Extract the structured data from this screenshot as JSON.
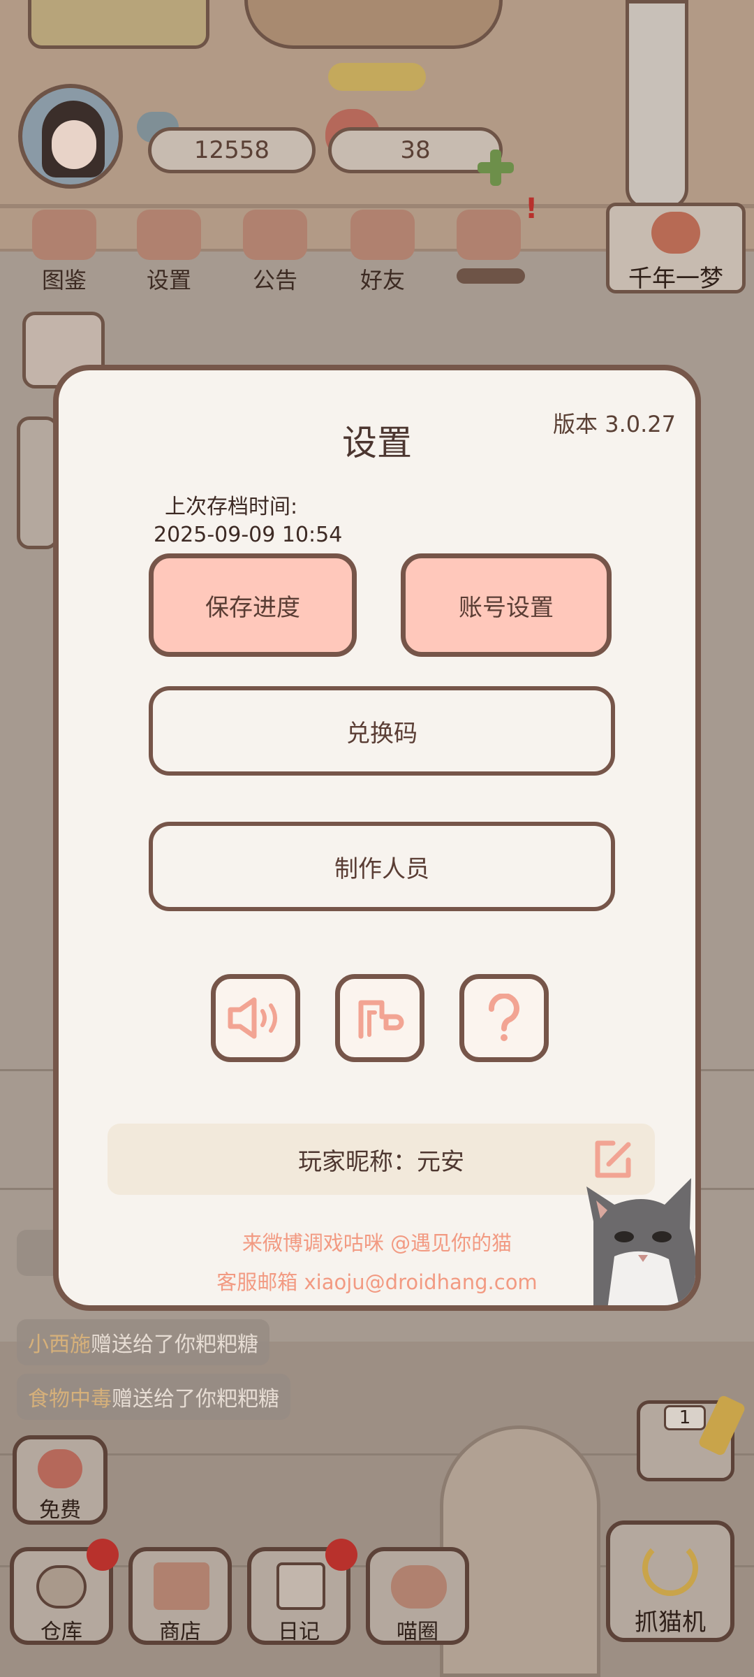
{
  "hud": {
    "fish_count": "12558",
    "heart_count": "38",
    "menu": [
      "图鉴",
      "设置",
      "公告",
      "好友"
    ],
    "badge": "!",
    "player_title": "千年一梦"
  },
  "chat": [
    {
      "name": "小西施",
      "text": "赠送给了你粑粑糖"
    },
    {
      "name": "食物中毒",
      "text": "赠送给了你粑粑糖"
    }
  ],
  "side": {
    "free": "免费",
    "claw_count": "1",
    "claw_machine": "抓猫机"
  },
  "bottom_nav": [
    "仓库",
    "商店",
    "日记",
    "喵圈"
  ],
  "dialog": {
    "title": "设置",
    "version": "版本 3.0.27",
    "save_time_label": "上次存档时间:",
    "save_time_value": "2025-09-09 10:54",
    "save_progress": "保存进度",
    "account_settings": "账号设置",
    "redeem_code": "兑换码",
    "credits": "制作人员",
    "nickname": "玩家昵称：元安",
    "weibo": "来微博调戏咕咪 @遇见你的猫",
    "email": "客服邮箱 xiaoju@droidhang.com"
  },
  "colors": {
    "dialog_bg": "#f7f3ee",
    "border": "#765549",
    "pink_button": "#ffc8bb",
    "link_text": "#f29a82",
    "icon_pink": "#f2a493"
  },
  "icons": [
    "sound-icon",
    "music-icon",
    "help-icon",
    "edit-icon"
  ]
}
